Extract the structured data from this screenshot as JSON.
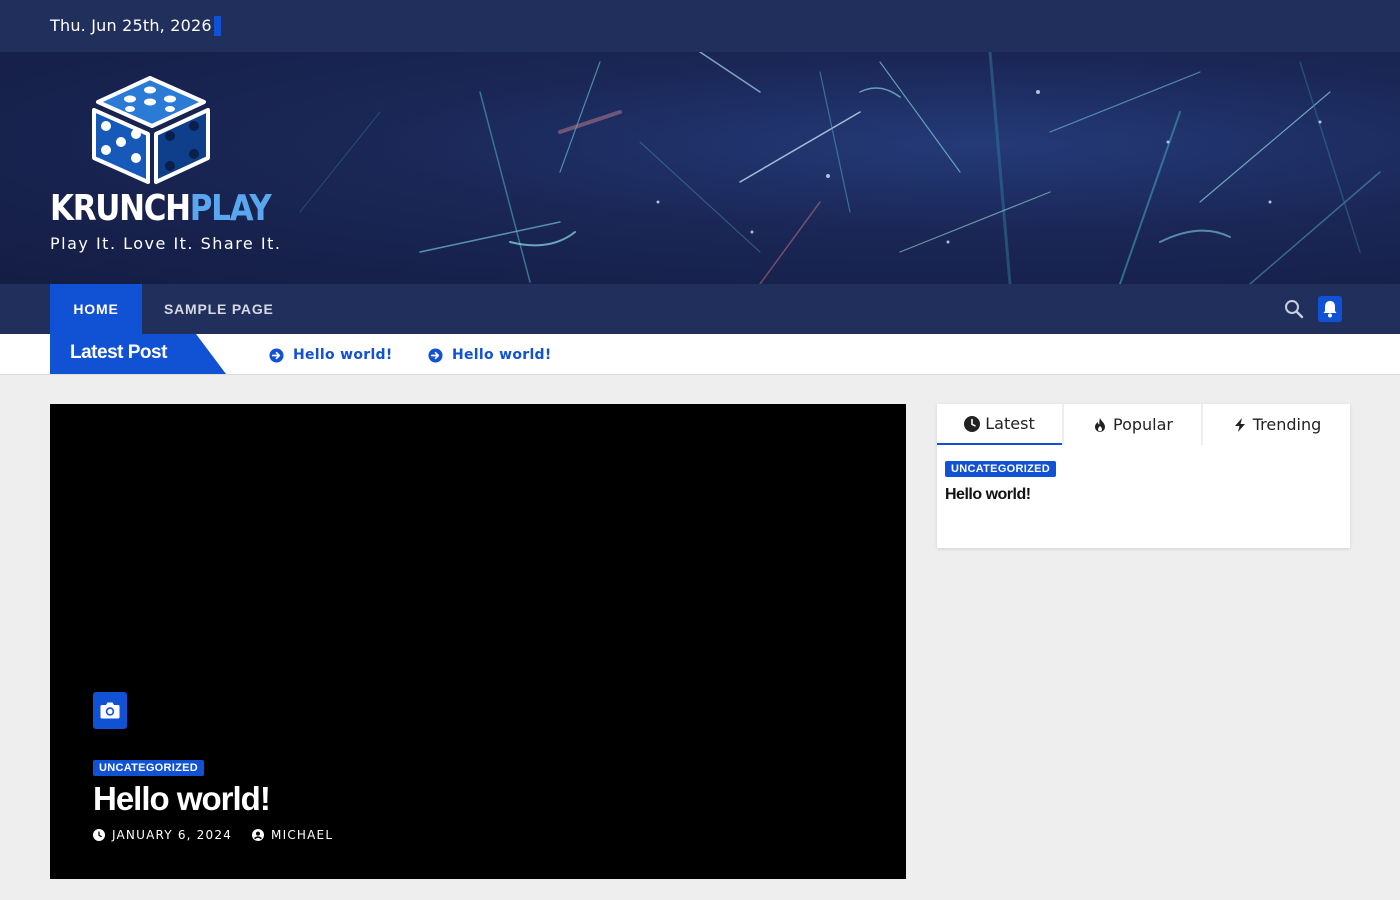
{
  "topbar": {
    "date": "Thu. Jun 25th, 2026"
  },
  "brand": {
    "name_part1": "KRUNCH",
    "name_part2": "PLAY",
    "tagline": "Play It. Love It. Share It."
  },
  "nav": {
    "items": [
      {
        "label": "HOME",
        "active": true
      },
      {
        "label": "SAMPLE PAGE",
        "active": false
      }
    ],
    "icons": [
      "search-icon",
      "bell-icon"
    ]
  },
  "ticker": {
    "label": "Latest Post",
    "items": [
      {
        "label": "Hello world!"
      },
      {
        "label": "Hello world!"
      }
    ]
  },
  "hero": {
    "category": "UNCATEGORIZED",
    "title": "Hello world!",
    "date": "JANUARY 6, 2024",
    "author": "MICHAEL"
  },
  "sidebar": {
    "tabs": [
      {
        "label": "Latest",
        "icon": "clock-icon"
      },
      {
        "label": "Popular",
        "icon": "fire-icon"
      },
      {
        "label": "Trending",
        "icon": "bolt-icon"
      }
    ],
    "post": {
      "category": "UNCATEGORIZED",
      "title": "Hello world!"
    }
  },
  "colors": {
    "navy": "#202f5b",
    "accent": "#1151d3",
    "background": "#eeeeee",
    "logo_blue": "#5aa7f0"
  }
}
